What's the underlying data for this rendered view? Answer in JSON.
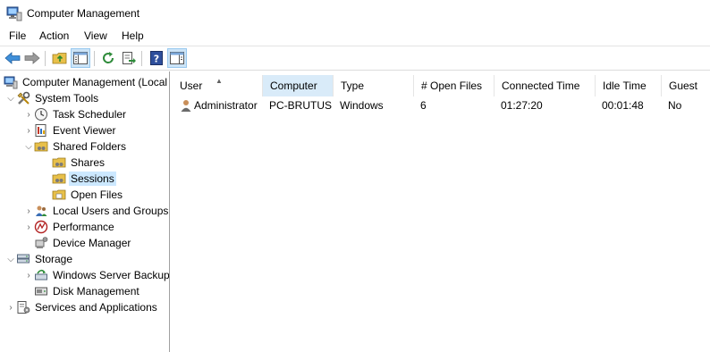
{
  "window": {
    "title": "Computer Management"
  },
  "menu": [
    "File",
    "Action",
    "View",
    "Help"
  ],
  "toolbar": {
    "buttons": [
      "back-icon",
      "forward-icon",
      "up-folder-icon",
      "show-hide-tree-icon",
      "refresh-icon",
      "export-list-icon",
      "help-icon",
      "show-hide-action-pane-icon"
    ]
  },
  "tree": {
    "items": [
      {
        "label": "Computer Management (Local"
      },
      {
        "label": "System Tools"
      },
      {
        "label": "Task Scheduler"
      },
      {
        "label": "Event Viewer"
      },
      {
        "label": "Shared Folders"
      },
      {
        "label": "Shares"
      },
      {
        "label": "Sessions"
      },
      {
        "label": "Open Files"
      },
      {
        "label": "Local Users and Groups"
      },
      {
        "label": "Performance"
      },
      {
        "label": "Device Manager"
      },
      {
        "label": "Storage"
      },
      {
        "label": "Windows Server Backup"
      },
      {
        "label": "Disk Management"
      },
      {
        "label": "Services and Applications"
      }
    ]
  },
  "list": {
    "columns": [
      "User",
      "Computer",
      "Type",
      "# Open Files",
      "Connected Time",
      "Idle Time",
      "Guest"
    ],
    "rows": [
      {
        "user": "Administrator",
        "computer": "PC-BRUTUS",
        "type": "Windows",
        "open_files": "6",
        "connected_time": "01:27:20",
        "idle_time": "00:01:48",
        "guest": "No"
      }
    ]
  }
}
